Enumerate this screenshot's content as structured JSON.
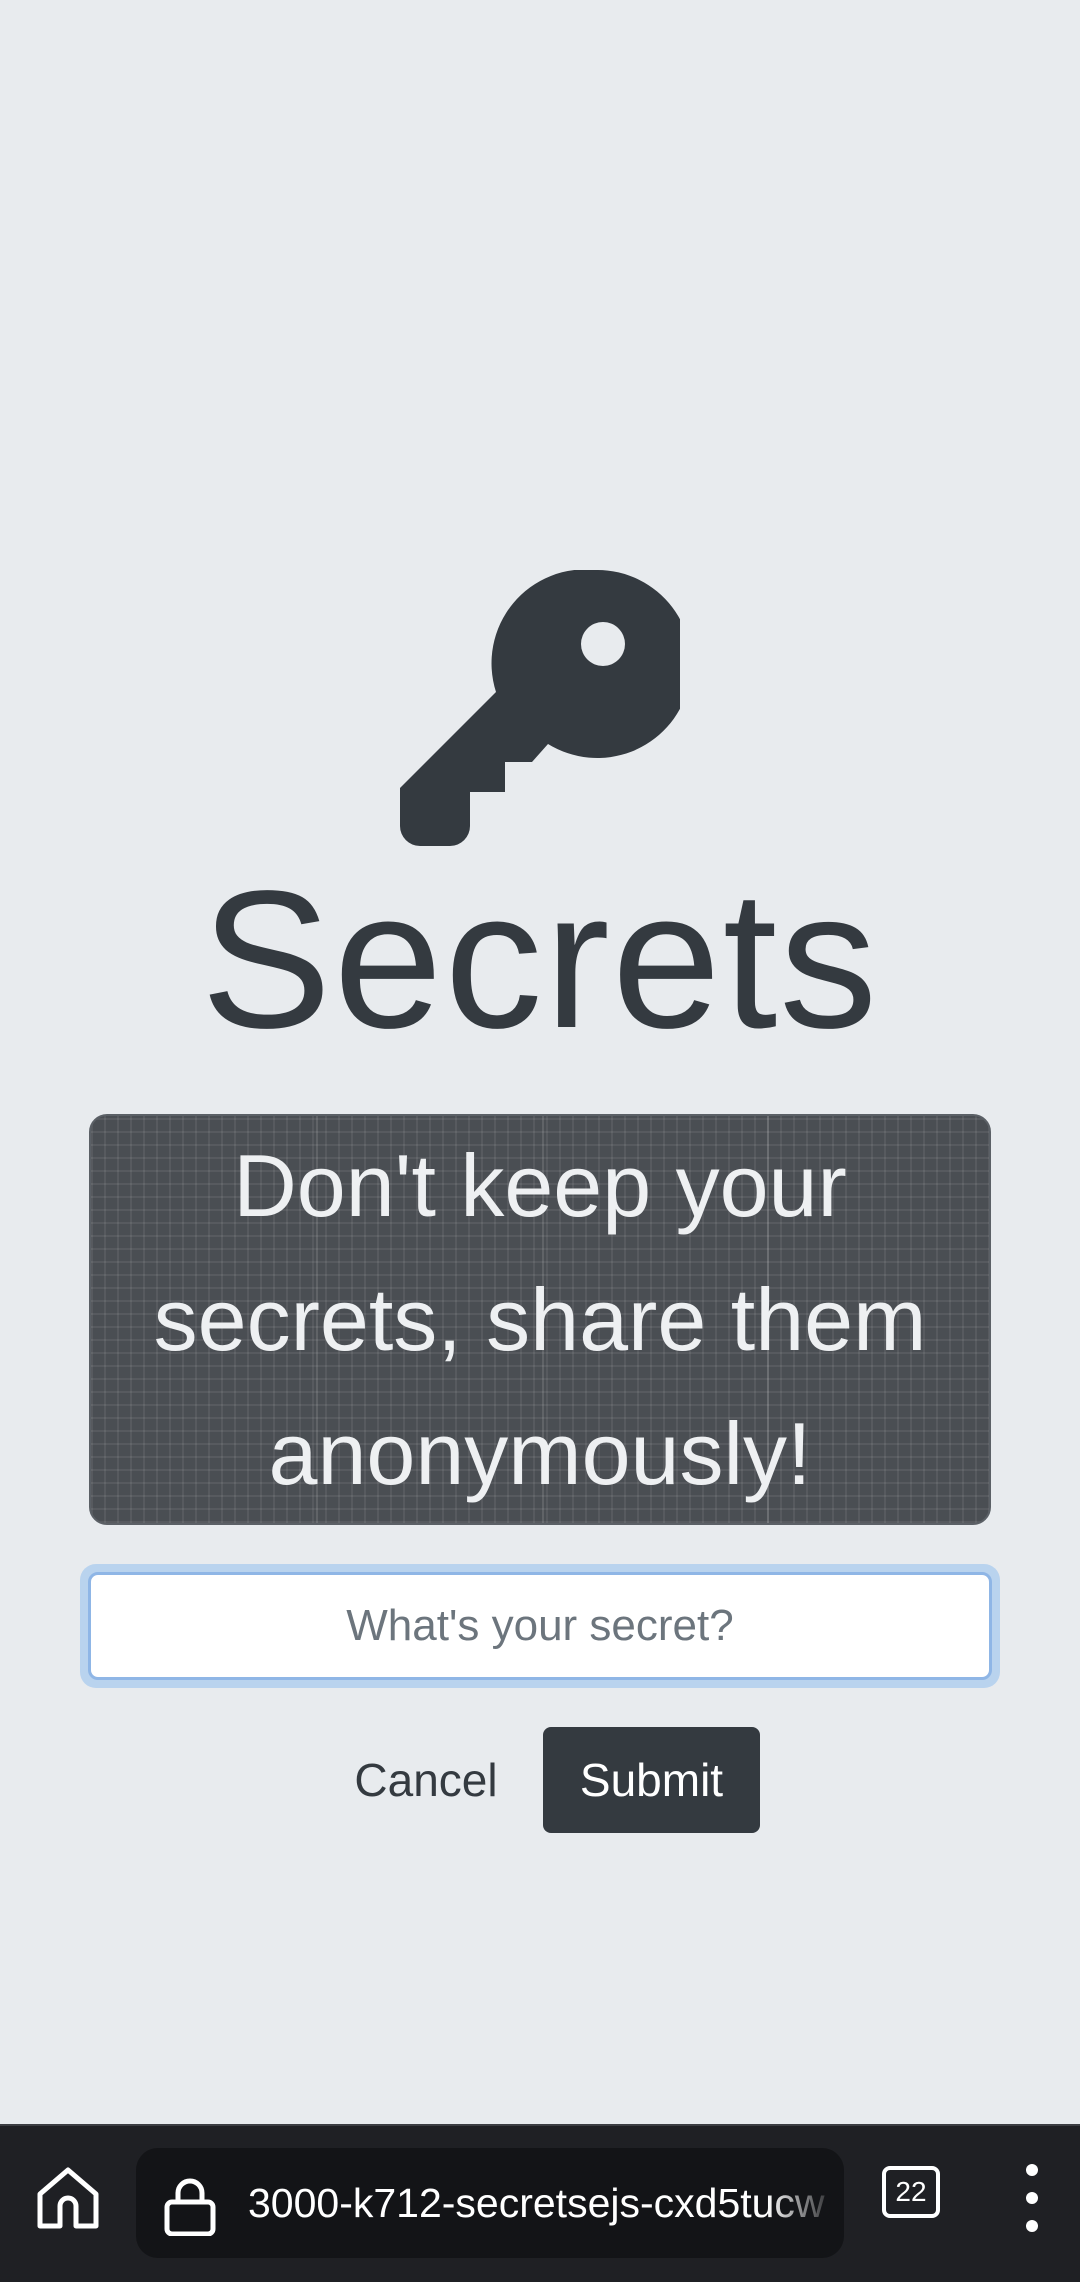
{
  "app": {
    "title": "Secrets",
    "tagline": "Don't keep your secrets, share them anonymously!",
    "key_icon": "key-icon"
  },
  "form": {
    "secret_placeholder": "What's your secret?",
    "secret_value": "",
    "cancel_label": "Cancel",
    "submit_label": "Submit"
  },
  "browser": {
    "url": "3000-k712-secretsejs-cxd5tucw",
    "tab_count": "22",
    "home_icon": "home-icon",
    "lock_icon": "lock-icon",
    "menu_icon": "more-vert-icon"
  },
  "colors": {
    "background": "#e8ebee",
    "primary_dark": "#343a40",
    "tagline_box": "#4a4e53",
    "input_focus_ring": "#b9d3ee",
    "browser_bar": "#1f2024"
  }
}
